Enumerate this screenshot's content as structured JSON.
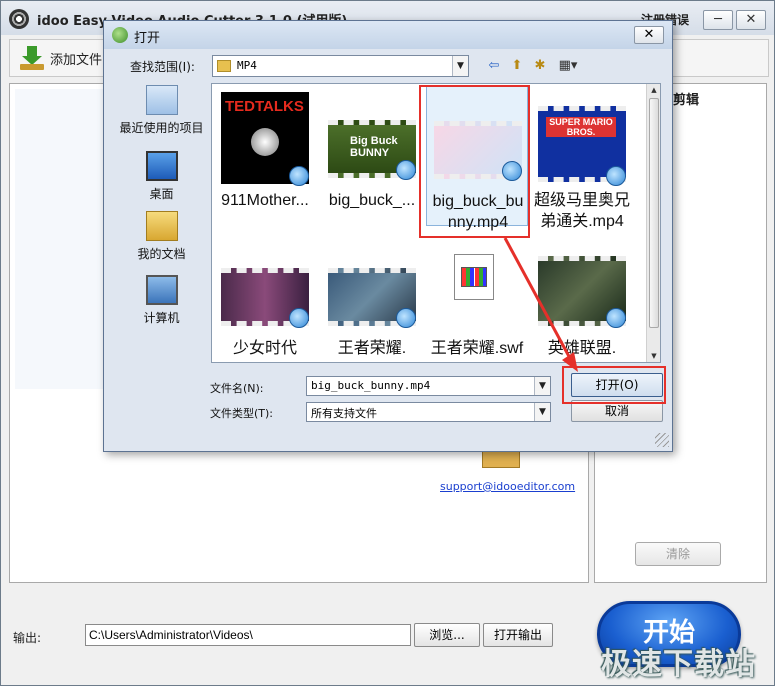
{
  "app": {
    "title": "idoo Easy Video Audio Cutter 3.1.0 (试用版)",
    "menu_label": "注册错误",
    "minimize": "─",
    "close": "✕",
    "add_file_label": "添加文件",
    "right_panel_title": "剪辑",
    "clear_label": "清除",
    "support_link": "support@idooeditor.com",
    "output_label": "输出:",
    "output_path": "C:\\Users\\Administrator\\Videos\\",
    "browse_label": "浏览...",
    "open_output_label": "打开输出",
    "start_label": "开始",
    "watermark": "极速下载站"
  },
  "dialog": {
    "title": "打开",
    "close": "✕",
    "look_in_label": "查找范围(I):",
    "look_in_value": "MP4",
    "places": [
      {
        "label": "最近使用的项目",
        "icon": "recent-items-icon"
      },
      {
        "label": "桌面",
        "icon": "desktop-icon"
      },
      {
        "label": "我的文档",
        "icon": "documents-icon"
      },
      {
        "label": "计算机",
        "icon": "computer-icon"
      }
    ],
    "files": [
      {
        "name": "911Mother...",
        "thumb_text": "TEDTALKS"
      },
      {
        "name": "big_buck_...",
        "thumb_text": "Big Buck BUNNY"
      },
      {
        "name": "big_buck_bunny.mp4",
        "line1": "big_buck_bu",
        "line2": "nny.mp4",
        "selected": true
      },
      {
        "name": "超级马里奥兄弟通关.mp4",
        "line1": "超级马里奥兄",
        "line2": "弟通关.mp4",
        "thumb_text": "SUPER MARIO BROS."
      },
      {
        "name": "少女时代",
        "line1": "少女时代"
      },
      {
        "name": "王者荣耀.",
        "line1": "王者荣耀."
      },
      {
        "name": "王者荣耀.swf",
        "line1": "王者荣耀.swf"
      },
      {
        "name": "英雄联盟.",
        "line1": "英雄联盟."
      }
    ],
    "filename_label": "文件名(N):",
    "filename_value": "big_buck_bunny.mp4",
    "filetype_label": "文件类型(T):",
    "filetype_value": "所有支持文件",
    "open_label": "打开(O)",
    "cancel_label": "取消"
  },
  "colors": {
    "highlight": "#e5302a",
    "start_button": "#1a5fd0"
  }
}
